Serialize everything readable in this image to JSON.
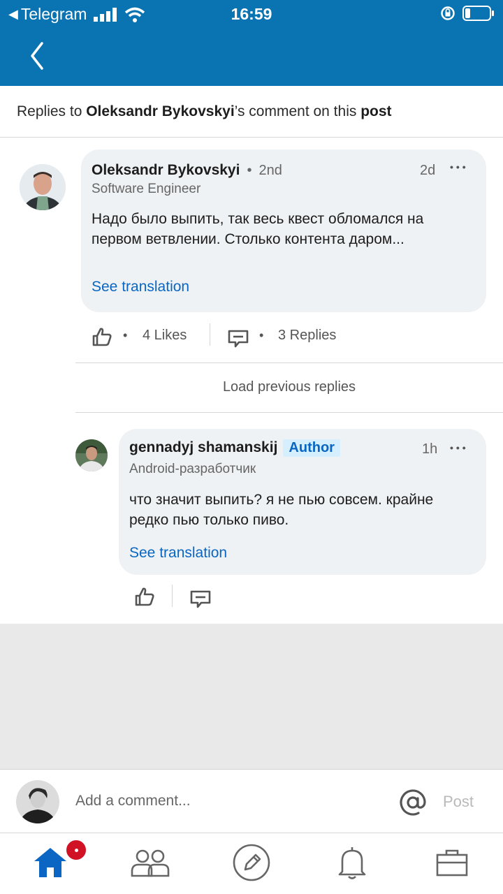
{
  "status_bar": {
    "back_app": "Telegram",
    "time": "16:59"
  },
  "subheader": {
    "prefix": "Replies to ",
    "author": "Oleksandr Bykovskyi",
    "middle": "’s comment on this ",
    "target": "post"
  },
  "comment": {
    "author": "Oleksandr Bykovskyi",
    "degree": "2nd",
    "time": "2d",
    "headline": "Software Engineer",
    "text": "Надо было выпить, так весь квест обломался на первом ветвлении. Столько контента даром...",
    "translate": "See translation",
    "likes": "4 Likes",
    "replies": "3 Replies",
    "more": "•••"
  },
  "load_previous": "Load previous replies",
  "reply": {
    "author": "gennadyj shamanskij",
    "badge": "Author",
    "time": "1h",
    "headline": "Android-разработчик",
    "text": "что значит выпить? я не пью совсем. крайне редко пью только пиво.",
    "translate": "See translation",
    "more": "•••"
  },
  "composer": {
    "placeholder": "Add a comment...",
    "post": "Post"
  },
  "tabs": [
    "home-icon",
    "my-network-icon",
    "post-icon",
    "notifications-icon",
    "jobs-icon"
  ],
  "colors": {
    "brand": "#0a73b1",
    "link": "#0a66c2",
    "badge": "#d11124"
  }
}
